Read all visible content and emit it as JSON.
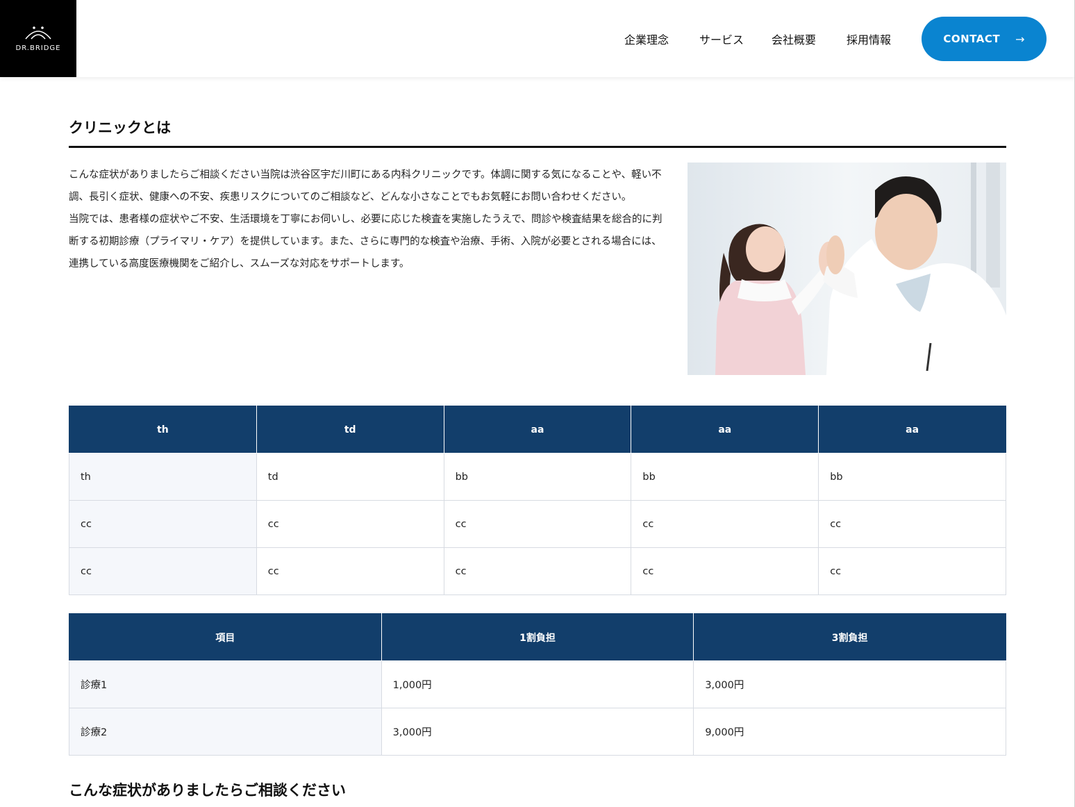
{
  "header": {
    "logo_text": "DR.BRIDGE",
    "nav": [
      "企業理念",
      "サービス",
      "会社概要",
      "採用情報"
    ],
    "contact_label": "CONTACT",
    "contact_arrow": "→",
    "colors": {
      "contact_bg": "#0a84d0",
      "logo_bg": "#000000"
    }
  },
  "main": {
    "section_title": "クリニックとは",
    "intro_paragraphs": [
      "こんな症状がありましたらご相談ください当院は渋谷区宇だ川町にある内科クリニックです。体調に関する気になることや、軽い不調、長引く症状、健康への不安、疾患リスクについてのご相談など、どんな小さなことでもお気軽にお問い合わせください。",
      "当院では、患者様の症状やご不安、生活環境を丁寧にお伺いし、必要に応じた検査を実施したうえで、問診や検査結果を総合的に判断する初期診療（プライマリ・ケア）を提供しています。また、さらに専門的な検査や治療、手術、入院が必要とされる場合には、連携している高度医療機関をご紹介し、スムーズな対応をサポートします。"
    ],
    "table1": {
      "headers": [
        "th",
        "td",
        "aa",
        "aa",
        "aa"
      ],
      "rows": [
        [
          "th",
          "td",
          "bb",
          "bb",
          "bb"
        ],
        [
          "cc",
          "cc",
          "cc",
          "cc",
          "cc"
        ],
        [
          "cc",
          "cc",
          "cc",
          "cc",
          "cc"
        ]
      ]
    },
    "table2": {
      "headers": [
        "項目",
        "1割負担",
        "3割負担"
      ],
      "rows": [
        [
          "診療1",
          "1,000円",
          "3,000円"
        ],
        [
          "診療2",
          "3,000円",
          "9,000円"
        ]
      ]
    },
    "section_title2": "こんな症状がありましたらご相談ください",
    "colors": {
      "table_header_bg": "#123e6b",
      "row_header_bg": "#f5f7fb"
    }
  }
}
